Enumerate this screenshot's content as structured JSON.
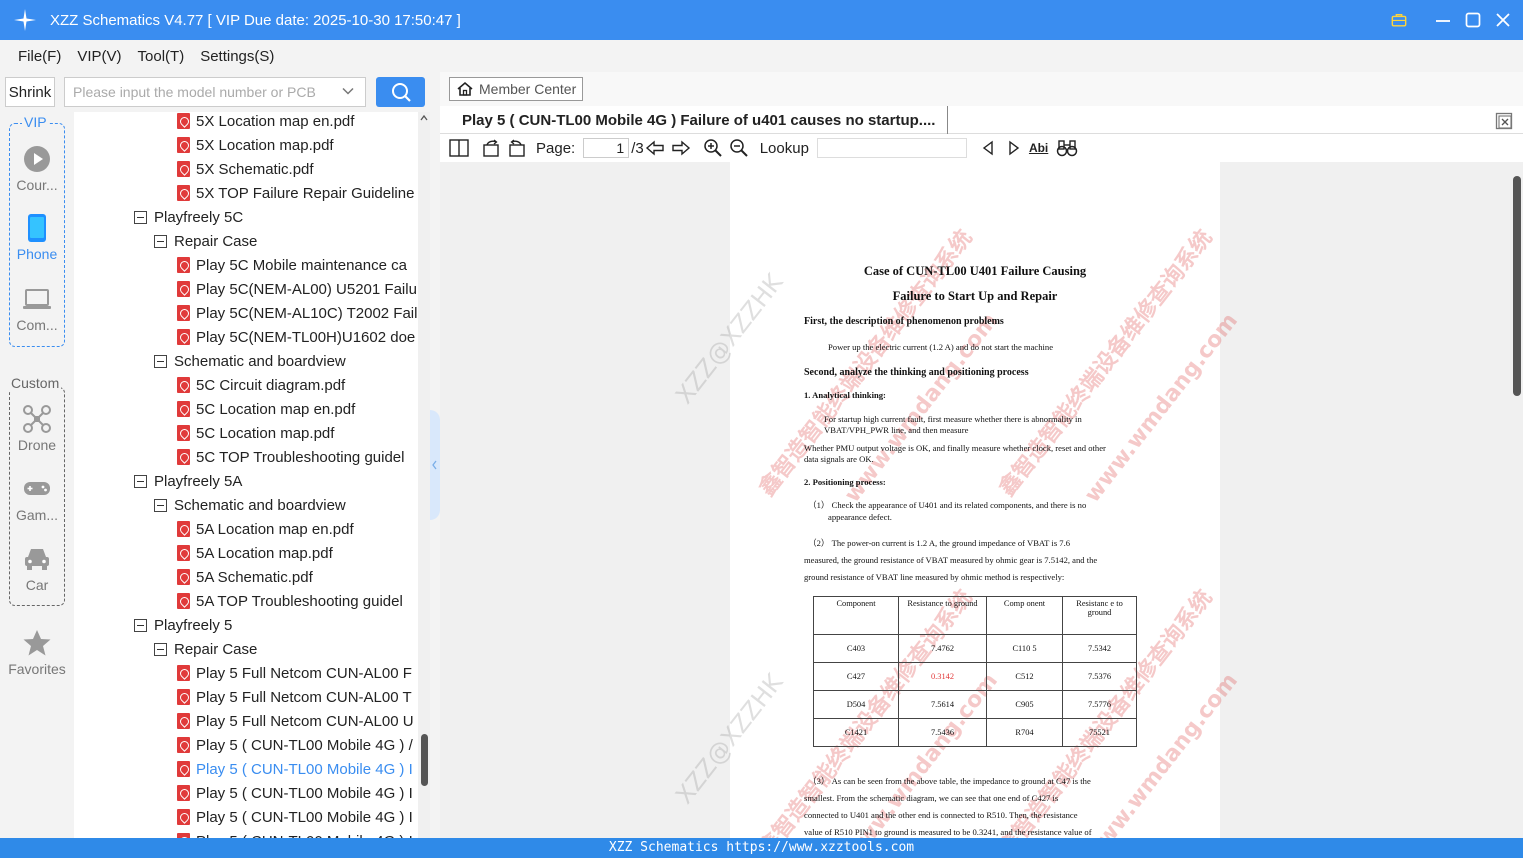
{
  "window": {
    "title": "XZZ Schematics V4.77 [ VIP Due date: 2025-10-30 17:50:47 ]"
  },
  "menu": {
    "items": [
      "File(F)",
      "VIP(V)",
      "Tool(T)",
      "Settings(S)"
    ]
  },
  "search": {
    "shrink_label": "Shrink",
    "placeholder": "Please input the model number or PCB"
  },
  "nav": {
    "vip_label": "VIP",
    "custom_label": "Custom",
    "items": [
      {
        "label": "Cour...",
        "icon": "play-icon"
      },
      {
        "label": "Phone",
        "icon": "phone-icon",
        "active": true
      },
      {
        "label": "Com...",
        "icon": "laptop-icon"
      },
      {
        "label": "Drone",
        "icon": "drone-icon"
      },
      {
        "label": "Gam...",
        "icon": "gamepad-icon"
      },
      {
        "label": "Car",
        "icon": "car-icon"
      },
      {
        "label": "Favorites",
        "icon": "star-icon"
      }
    ]
  },
  "tree": {
    "rows": [
      {
        "label": "5X Location map en.pdf",
        "kind": "pdf"
      },
      {
        "label": "5X Location map.pdf",
        "kind": "pdf"
      },
      {
        "label": "5X Schematic.pdf",
        "kind": "pdf"
      },
      {
        "label": "5X TOP Failure Repair Guideline",
        "kind": "pdf"
      },
      {
        "label": "Playfreely 5C",
        "kind": "folder1"
      },
      {
        "label": "Repair Case",
        "kind": "folder2"
      },
      {
        "label": "Play 5C Mobile maintenance ca",
        "kind": "pdf"
      },
      {
        "label": "Play 5C(NEM-AL00) U5201 Failu",
        "kind": "pdf"
      },
      {
        "label": "Play 5C(NEM-AL10C) T2002 Fail",
        "kind": "pdf"
      },
      {
        "label": "Play 5C(NEM-TL00H)U1602 doe",
        "kind": "pdf"
      },
      {
        "label": "Schematic and boardview",
        "kind": "folder2"
      },
      {
        "label": "5C Circuit diagram.pdf",
        "kind": "pdf"
      },
      {
        "label": "5C Location map en.pdf",
        "kind": "pdf"
      },
      {
        "label": "5C Location map.pdf",
        "kind": "pdf"
      },
      {
        "label": "5C TOP Troubleshooting guidel",
        "kind": "pdf"
      },
      {
        "label": "Playfreely 5A",
        "kind": "folder1"
      },
      {
        "label": "Schematic and boardview",
        "kind": "folder2"
      },
      {
        "label": "5A Location map en.pdf",
        "kind": "pdf"
      },
      {
        "label": "5A Location map.pdf",
        "kind": "pdf"
      },
      {
        "label": "5A Schematic.pdf",
        "kind": "pdf"
      },
      {
        "label": "5A TOP Troubleshooting guidel",
        "kind": "pdf"
      },
      {
        "label": "Playfreely 5",
        "kind": "folder1"
      },
      {
        "label": "Repair Case",
        "kind": "folder2"
      },
      {
        "label": "Play 5 Full Netcom CUN-AL00 F",
        "kind": "pdf"
      },
      {
        "label": "Play 5 Full Netcom CUN-AL00 T",
        "kind": "pdf"
      },
      {
        "label": "Play 5 Full Netcom CUN-AL00 U",
        "kind": "pdf"
      },
      {
        "label": "Play 5 ( CUN-TL00 Mobile 4G ) /",
        "kind": "pdf"
      },
      {
        "label": "Play 5 ( CUN-TL00 Mobile 4G ) I",
        "kind": "pdf",
        "selected": true
      },
      {
        "label": "Play 5 ( CUN-TL00 Mobile 4G ) I",
        "kind": "pdf"
      },
      {
        "label": "Play 5 ( CUN-TL00 Mobile 4G ) I",
        "kind": "pdf"
      },
      {
        "label": "Play 5 ( CUN-TL00 Mobile 4G ) I",
        "kind": "pdf"
      }
    ]
  },
  "viewer": {
    "member_center": "Member Center",
    "tab_title": "Play 5 ( CUN-TL00 Mobile 4G ) Failure of u401 causes no startup....",
    "page_label": "Page:",
    "page_current": "1",
    "page_total": "/3",
    "lookup_label": "Lookup",
    "abi_label": "Abi"
  },
  "document": {
    "title_line1": "Case of CUN-TL00 U401 Failure Causing",
    "title_line2": "Failure to Start Up and Repair",
    "h1": "First, the description of phenomenon problems",
    "p1": "Power up the electric current (1.2 A) and do not start the machine",
    "h2": "Second, analyze the thinking and positioning process",
    "h3": "1. Analytical thinking:",
    "p2a": "For startup high current fault, first measure whether there is abnormality in",
    "p2b": "VBAT/VPH_PWR line, and then measure",
    "p3a": "Whether PMU output voltage is OK, and finally measure whether clock, reset and other",
    "p3b": "data signals are OK.",
    "h4": "2. Positioning process:",
    "p4a": "（1） Check the appearance of U401 and its related components, and there is no",
    "p4b": "appearance defect.",
    "p5a": "（2） The power-on current is 1.2 A, the ground impedance of VBAT is 7.6",
    "p5b": "measured, the ground resistance of VBAT measured by ohmic gear is 7.5142, and the",
    "p5c": "ground resistance of VBAT line measured by ohmic method is respectively:",
    "table": {
      "headers": [
        "Component",
        "Resistance to ground",
        "Comp onent",
        "Resistanc e to ground"
      ],
      "rows": [
        [
          "C403",
          "7.4762",
          "C110 5",
          "7.5342"
        ],
        [
          "C427",
          "0.3142",
          "C512",
          "7.5376"
        ],
        [
          "D504",
          "7.5614",
          "C905",
          "7.5776"
        ],
        [
          "C1421",
          "7.5436",
          "R704",
          "75521"
        ]
      ]
    },
    "p6a": "（3） As can be seen from the above table, the impedance to ground at C47 is the",
    "p6b": "smallest. From the schematic diagram, we can see that one end of C427 is",
    "p6c": "connected to U401 and the other end is connected to R510. Then, the resistance",
    "p6d": "value of R510 PIN1 to ground is measured to be 0.3241, and the resistance value of",
    "watermark_red": "鑫智造智能终端设备维修查询系统",
    "watermark_url": "www.wmdang.com",
    "watermark_gray": "XZZ@XZZHK",
    "highlight_color": "#e23a3a"
  },
  "status": {
    "text": "XZZ Schematics https://www.xzztools.com"
  },
  "colors": {
    "accent": "#3a8df0",
    "statusbar": "#2f8ae8"
  }
}
